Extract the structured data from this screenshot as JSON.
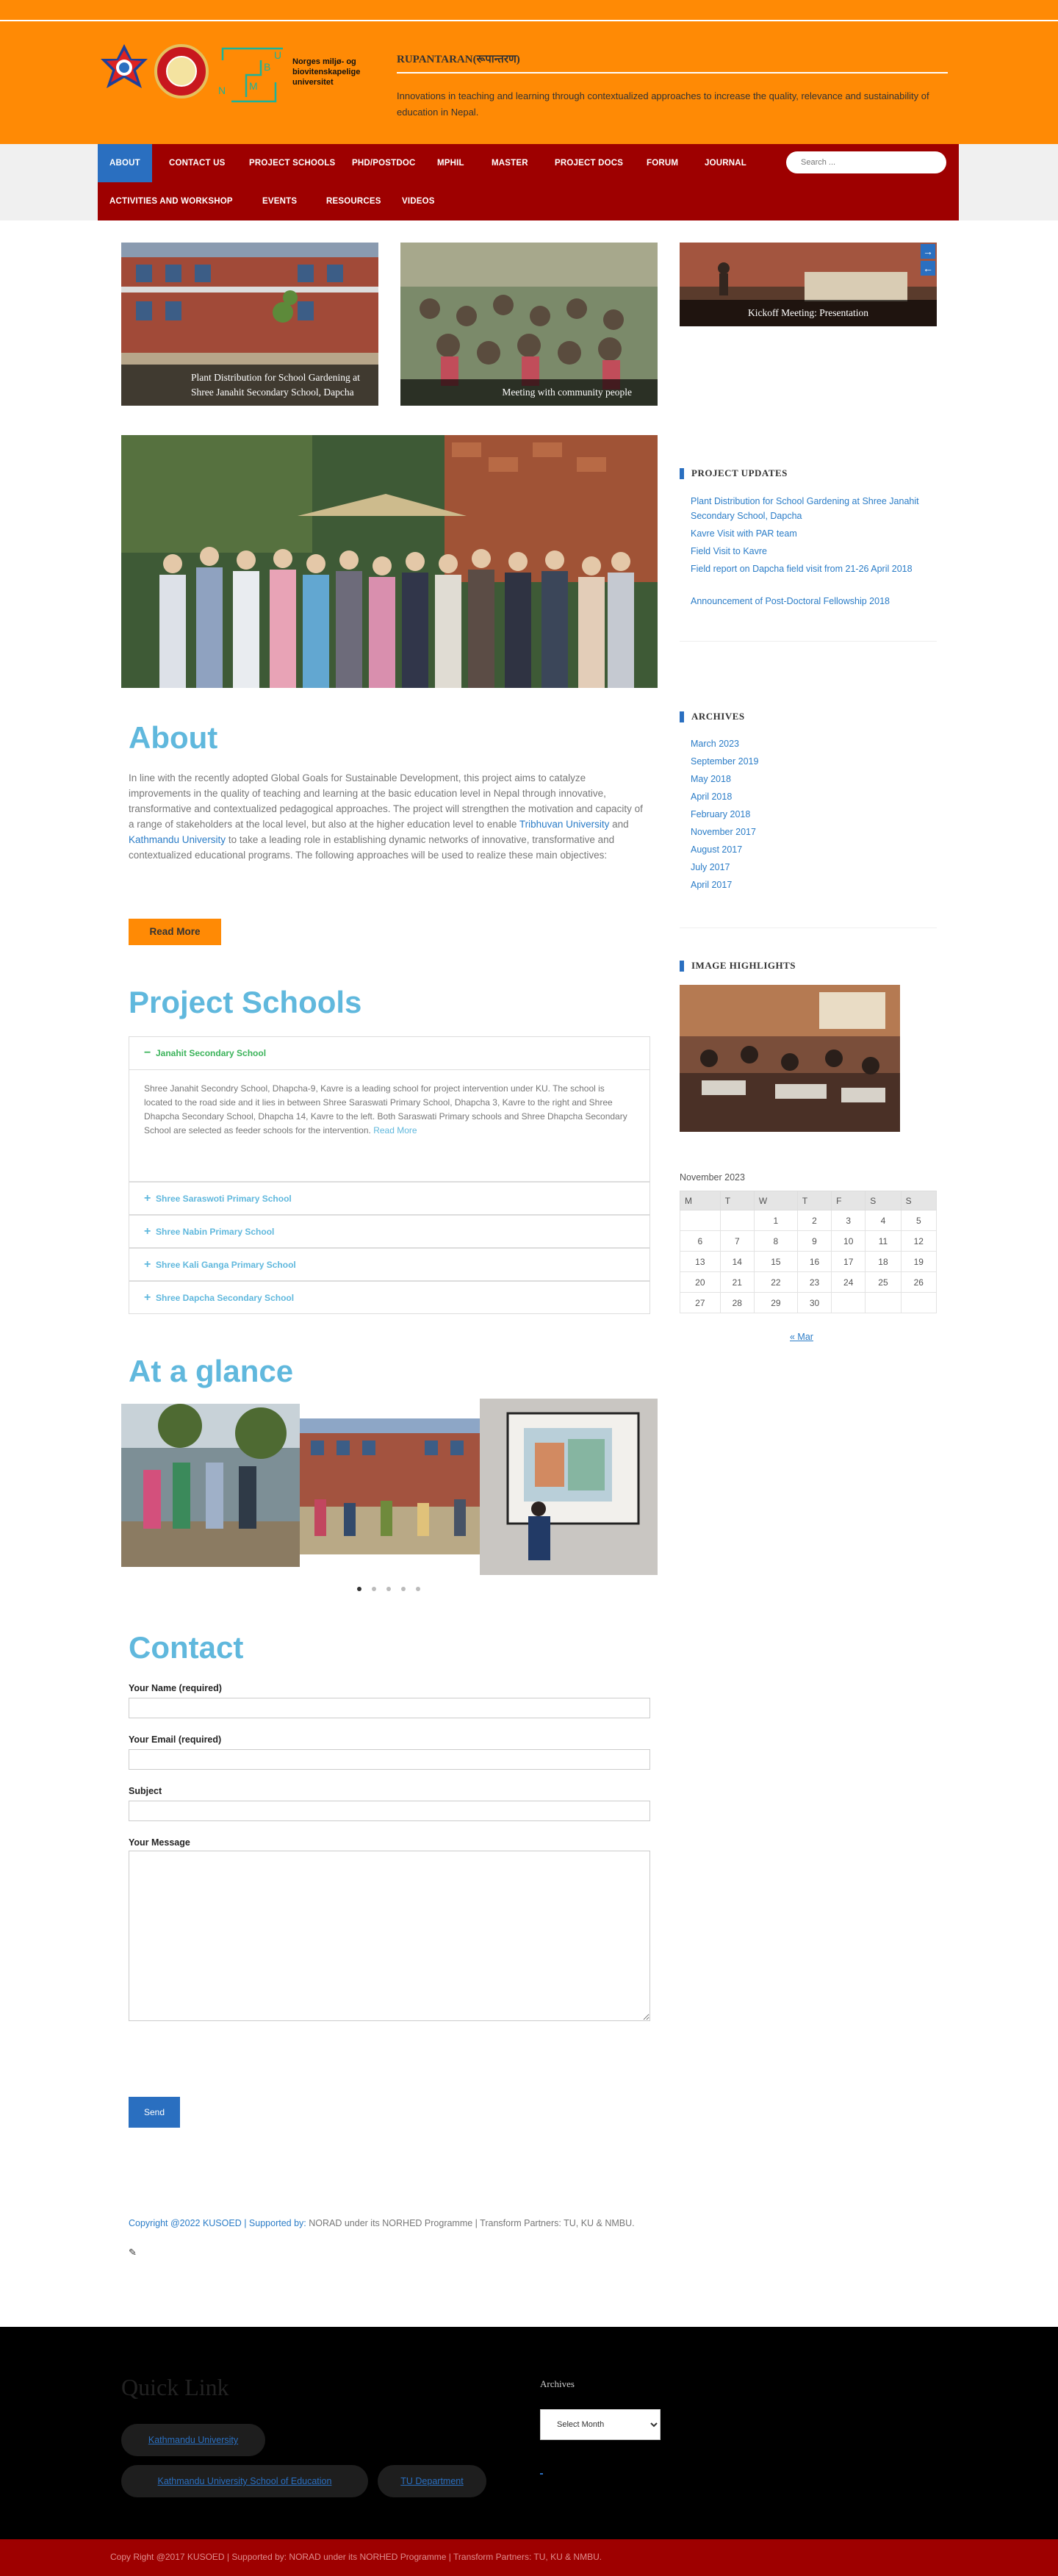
{
  "site": {
    "logo3_letters": [
      "N",
      "M",
      "B",
      "U"
    ],
    "logo3_text": [
      "Norges miljø- og",
      "biovitenskapelige",
      "universitet"
    ],
    "title": "RUPANTARAN(रूपान्तरण)",
    "description": "Innovations in teaching and learning through contextualized approaches to increase the quality, relevance and sustainability of education in Nepal."
  },
  "nav": {
    "row1": [
      "ABOUT",
      "CONTACT US",
      "PROJECT SCHOOLS",
      "PHD/POSTDOC",
      "MPHIL",
      "MASTER",
      "PROJECT DOCS",
      "FORUM",
      "JOURNAL"
    ],
    "row2": [
      "ACTIVITIES AND WORKSHOP",
      "EVENTS",
      "RESOURCES",
      "VIDEOS"
    ],
    "search_placeholder": "Search ..."
  },
  "slides": [
    {
      "caption": "Plant Distribution for School Gardening at Shree Janahit Secondary School, Dapcha"
    },
    {
      "caption": "Meeting with community people"
    },
    {
      "caption": "Kickoff Meeting: Presentation"
    }
  ],
  "about": {
    "heading": "About",
    "text_1": "In line with the recently adopted Global Goals for Sustainable Development, this project aims to catalyze improvements in the quality of teaching and learning at the basic education level in Nepal through innovative, transformative and contextualized pedagogical approaches. The project will strengthen the motivation and capacity of a range of stakeholders at the local level, but also at the higher education level to enable ",
    "link_1": "Tribhuvan University",
    "text_2": " and ",
    "link_2": "Kathmandu University",
    "text_3": " to take a leading role in establishing dynamic networks of innovative, transformative and contextualized educational programs. The following approaches will be used to realize these main objectives:",
    "read_more": "Read More"
  },
  "project_schools": {
    "heading": "Project Schools",
    "open_title": "Janahit Secondary School",
    "open_text": "Shree Janahit Secondry School, Dhapcha-9, Kavre is a leading school for project intervention under KU. The school is located to the road side and it lies in between Shree Saraswati Primary School, Dhapcha 3, Kavre to the right and Shree Dhapcha Secondary School, Dhapcha 14, Kavre to the left. Both Saraswati Primary schools and Shree Dhapcha Secondary School are selected as feeder schools for the intervention. ",
    "open_link": "Read More",
    "others": [
      "Shree Saraswoti Primary School",
      "Shree Nabin Primary School",
      "Shree Kali Ganga Primary School",
      "Shree Dapcha Secondary School"
    ]
  },
  "glance": {
    "heading": "At a glance",
    "dots": 5
  },
  "contact": {
    "heading": "Contact",
    "name_label": "Your Name (required)",
    "email_label": "Your Email (required)",
    "subject_label": "Subject",
    "message_label": "Your Message",
    "send": "Send",
    "copyright_link": "Copyright @2022 KUSOED | Supported by:",
    "copyright_text": " NORAD under its NORHED Programme | Transform Partners: TU, KU & NMBU."
  },
  "sidebar": {
    "updates_title": "PROJECT UPDATES",
    "updates": [
      "Plant Distribution for School Gardening at Shree Janahit Secondary School, Dapcha",
      "Kavre Visit with PAR team",
      "Field Visit to Kavre",
      "Field report on Dapcha field visit from 21-26 April 2018",
      "Announcement of Post-Doctoral Fellowship 2018"
    ],
    "archives_title": "ARCHIVES",
    "archives": [
      "March 2023",
      "September 2019",
      "May 2018",
      "April 2018",
      "February 2018",
      "November 2017",
      "August 2017",
      "July 2017",
      "April 2017"
    ],
    "highlights_title": "IMAGE HIGHLIGHTS",
    "calendar_caption": "November 2023",
    "calendar_days": [
      "M",
      "T",
      "W",
      "T",
      "F",
      "S",
      "S"
    ],
    "calendar_weeks": [
      [
        "",
        "",
        "1",
        "2",
        "3",
        "4",
        "5"
      ],
      [
        "6",
        "7",
        "8",
        "9",
        "10",
        "11",
        "12"
      ],
      [
        "13",
        "14",
        "15",
        "16",
        "17",
        "18",
        "19"
      ],
      [
        "20",
        "21",
        "22",
        "23",
        "24",
        "25",
        "26"
      ],
      [
        "27",
        "28",
        "29",
        "30",
        "",
        "",
        ""
      ]
    ],
    "calendar_prev": "« Mar"
  },
  "footer": {
    "quick_link": "Quick Link",
    "links": [
      "Kathmandu University",
      "Kathmandu University School of Education",
      "TU Department"
    ],
    "archives_title": "Archives",
    "select_month": "Select Month",
    "bottom": "Copy Right @2017 KUSOED | Supported by: NORAD under its NORHED Programme | Transform Partners: TU, KU & NMBU."
  },
  "colors": {
    "orange": "#ff8a05",
    "nav_red": "#9e0000",
    "accent_blue": "#2a6fc0",
    "heading_blue": "#60b8dd"
  }
}
